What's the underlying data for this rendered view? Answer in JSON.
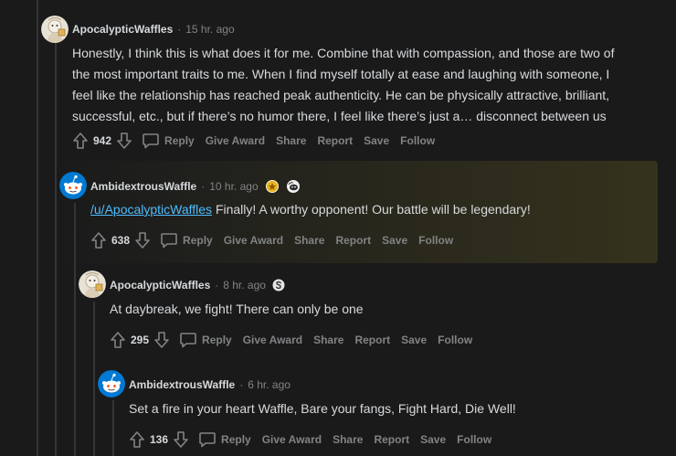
{
  "comments": [
    {
      "author": "ApocalypticWaffles",
      "time": "15 hr. ago",
      "avatar": "waffle-avatar",
      "lines": [
        "Honestly, I think this is what does it for me. Combine that with compassion, and those are two of",
        "the most important traits to me. When I find myself totally at ease and laughing with someone, I",
        "feel like the relationship has reached peak authenticity. He can be physically attractive, brilliant,",
        "successful, etc., but if there’s no humor there, I feel like there’s just a… disconnect between us"
      ],
      "score": "942"
    },
    {
      "author": "AmbidextrousWaffle",
      "time": "10 hr. ago",
      "avatar": "snoo-avatar",
      "awards": [
        "award-badge-icon",
        "snoo-award-icon"
      ],
      "link": "/u/ApocalypticWaffles",
      "text": " Finally! A worthy opponent! Our battle will be legendary!",
      "score": "638"
    },
    {
      "author": "ApocalypticWaffles",
      "time": "8 hr. ago",
      "avatar": "waffle-avatar",
      "awards": [
        "silver-award-icon"
      ],
      "text": "At daybreak, we fight! There can only be one",
      "score": "295"
    },
    {
      "author": "AmbidextrousWaffle",
      "time": "6 hr. ago",
      "avatar": "snoo-avatar",
      "text": "Set a fire in your heart Waffle, Bare your fangs, Fight Hard, Die Well!",
      "score": "136"
    }
  ],
  "actions": {
    "reply": "Reply",
    "give_award": "Give Award",
    "share": "Share",
    "report": "Report",
    "save": "Save",
    "follow": "Follow"
  },
  "colors": {
    "background": "#1a1a1b",
    "text": "#d7dadc",
    "muted": "#818384",
    "link": "#4fbcff",
    "thread_line": "#343536"
  }
}
